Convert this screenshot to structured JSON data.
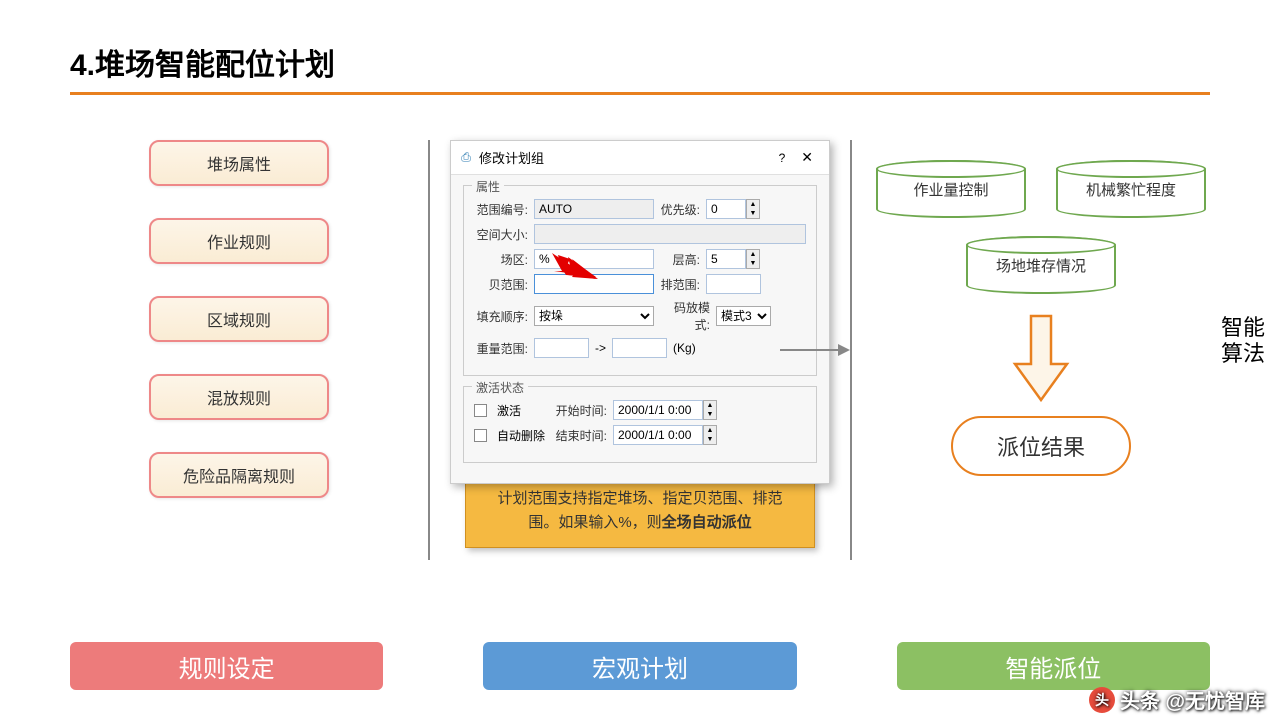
{
  "title": "4.堆场智能配位计划",
  "rules": {
    "items": [
      "堆场属性",
      "作业规则",
      "区域规则",
      "混放规则",
      "危险品隔离规则"
    ]
  },
  "dialog": {
    "title": "修改计划组",
    "help": "?",
    "close": "✕",
    "section1": "属性",
    "section2": "激活状态",
    "labels": {
      "range_no": "范围编号:",
      "priority": "优先级:",
      "space": "空间大小:",
      "area": "场区:",
      "layer": "层高:",
      "bay_range": "贝范围:",
      "row_range": "排范围:",
      "fill_order": "填充顺序:",
      "stack_mode": "码放模式:",
      "weight_range": "重量范围:",
      "weight_unit": "(Kg)",
      "activate": "激活",
      "start_time": "开始时间:",
      "auto_delete": "自动删除",
      "end_time": "结束时间:"
    },
    "values": {
      "range_no": "AUTO",
      "priority": "0",
      "area": "%",
      "layer": "5",
      "fill_order": "按垛",
      "stack_mode": "模式3",
      "arrow": "->",
      "start_time": "2000/1/1 0:00",
      "end_time": "2000/1/1 0:00"
    }
  },
  "callout": {
    "text_a": "计划范围支持指定堆场、指定贝范围、排范围。如果输入%，则",
    "text_b": "全场自动派位"
  },
  "cylinders": {
    "c1": "作业量控制",
    "c2": "机械繁忙程度",
    "c3": "场地堆存情况"
  },
  "algo_label_1": "智能",
  "algo_label_2": "算法",
  "result": "派位结果",
  "bottom": {
    "b1": "规则设定",
    "b2": "宏观计划",
    "b3": "智能派位"
  },
  "watermark": "头条 @无忧智库"
}
